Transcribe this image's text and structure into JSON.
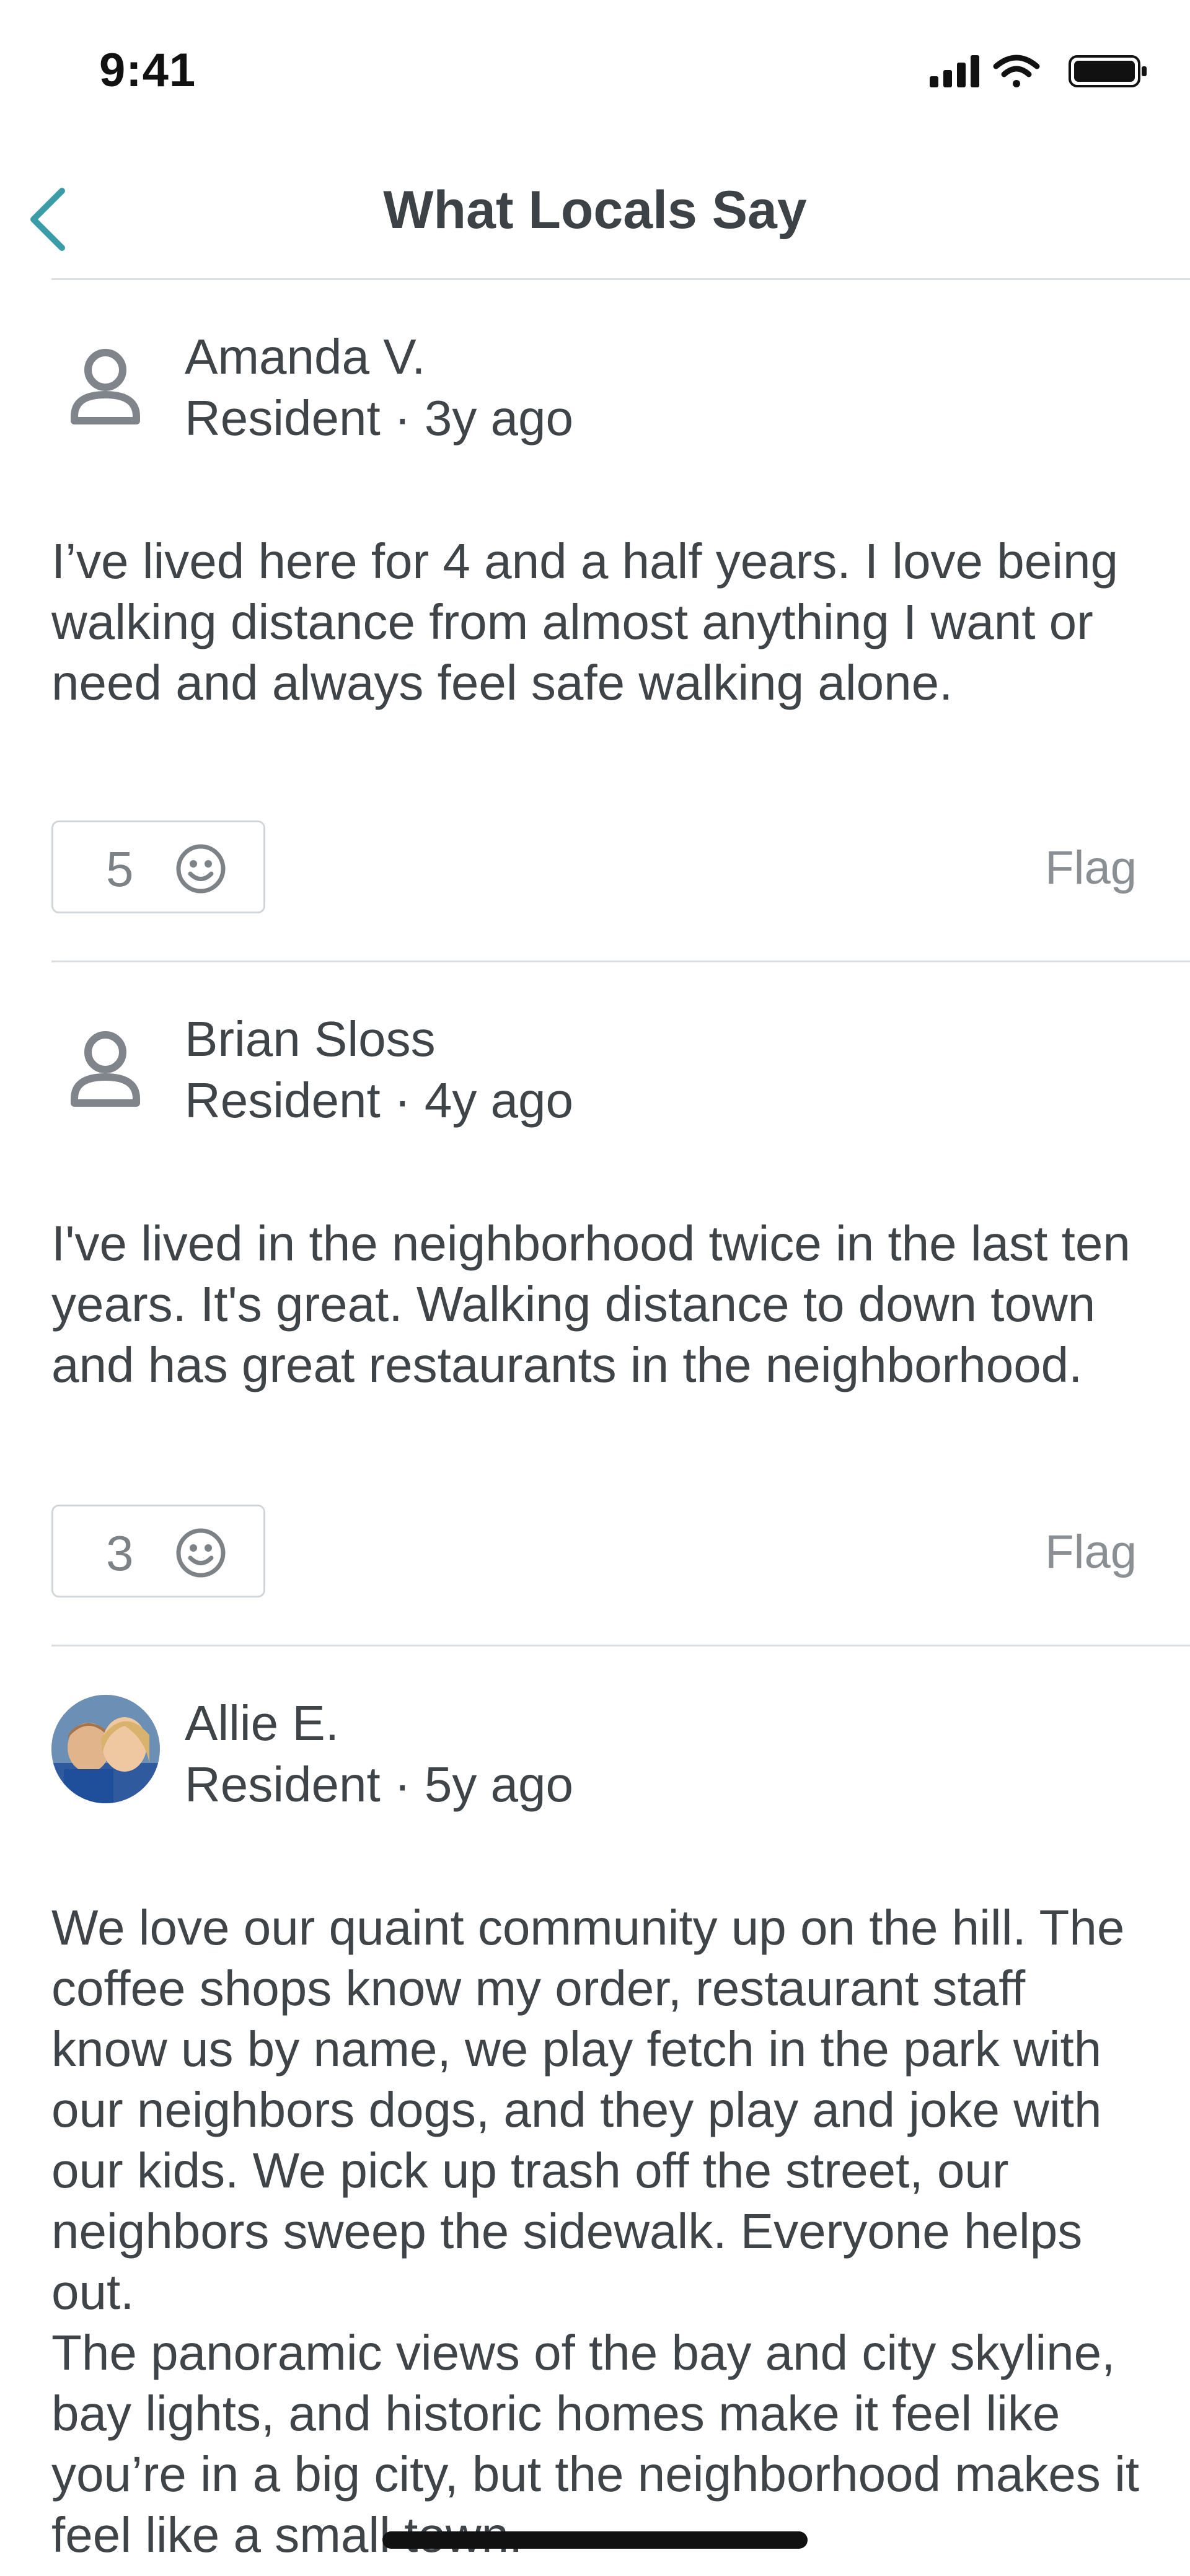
{
  "status_bar": {
    "time": "9:41"
  },
  "header": {
    "title": "What Locals Say"
  },
  "reviews": [
    {
      "author": "Amanda V.",
      "meta": "Resident · 3y ago",
      "body": "I’ve lived here for 4 and a half years. I love being walking distance from almost anything I want or need and always feel safe walking alone.",
      "reactions": "5",
      "flag_label": "Flag"
    },
    {
      "author": "Brian Sloss",
      "meta": "Resident · 4y ago",
      "body": "I've lived in the neighborhood twice in the last ten years. It's great. Walking distance to down town and has great restaurants in the neighborhood.",
      "reactions": "3",
      "flag_label": "Flag"
    },
    {
      "author": "Allie E.",
      "meta": "Resident · 5y ago",
      "body": "We love our quaint community up on the hill. The coffee shops know my order, restaurant staff know us by name, we play fetch in the park with our neighbors dogs, and they play and joke with our kids. We pick up trash off the street, our neighbors sweep the sidewalk. Everyone helps out.\nThe panoramic views of the bay and city skyline, bay lights, and historic homes make it feel like you’re in a big city, but the neighborhood makes it feel like a small town."
    }
  ],
  "icons": {
    "back": "chevron-left-icon",
    "avatar_placeholder": "person-outline-icon",
    "reaction": "smiley-face-icon"
  },
  "colors": {
    "accent": "#3a9ca6",
    "text": "#3f4448",
    "muted": "#8a8f94",
    "divider": "#dcdfe2"
  }
}
